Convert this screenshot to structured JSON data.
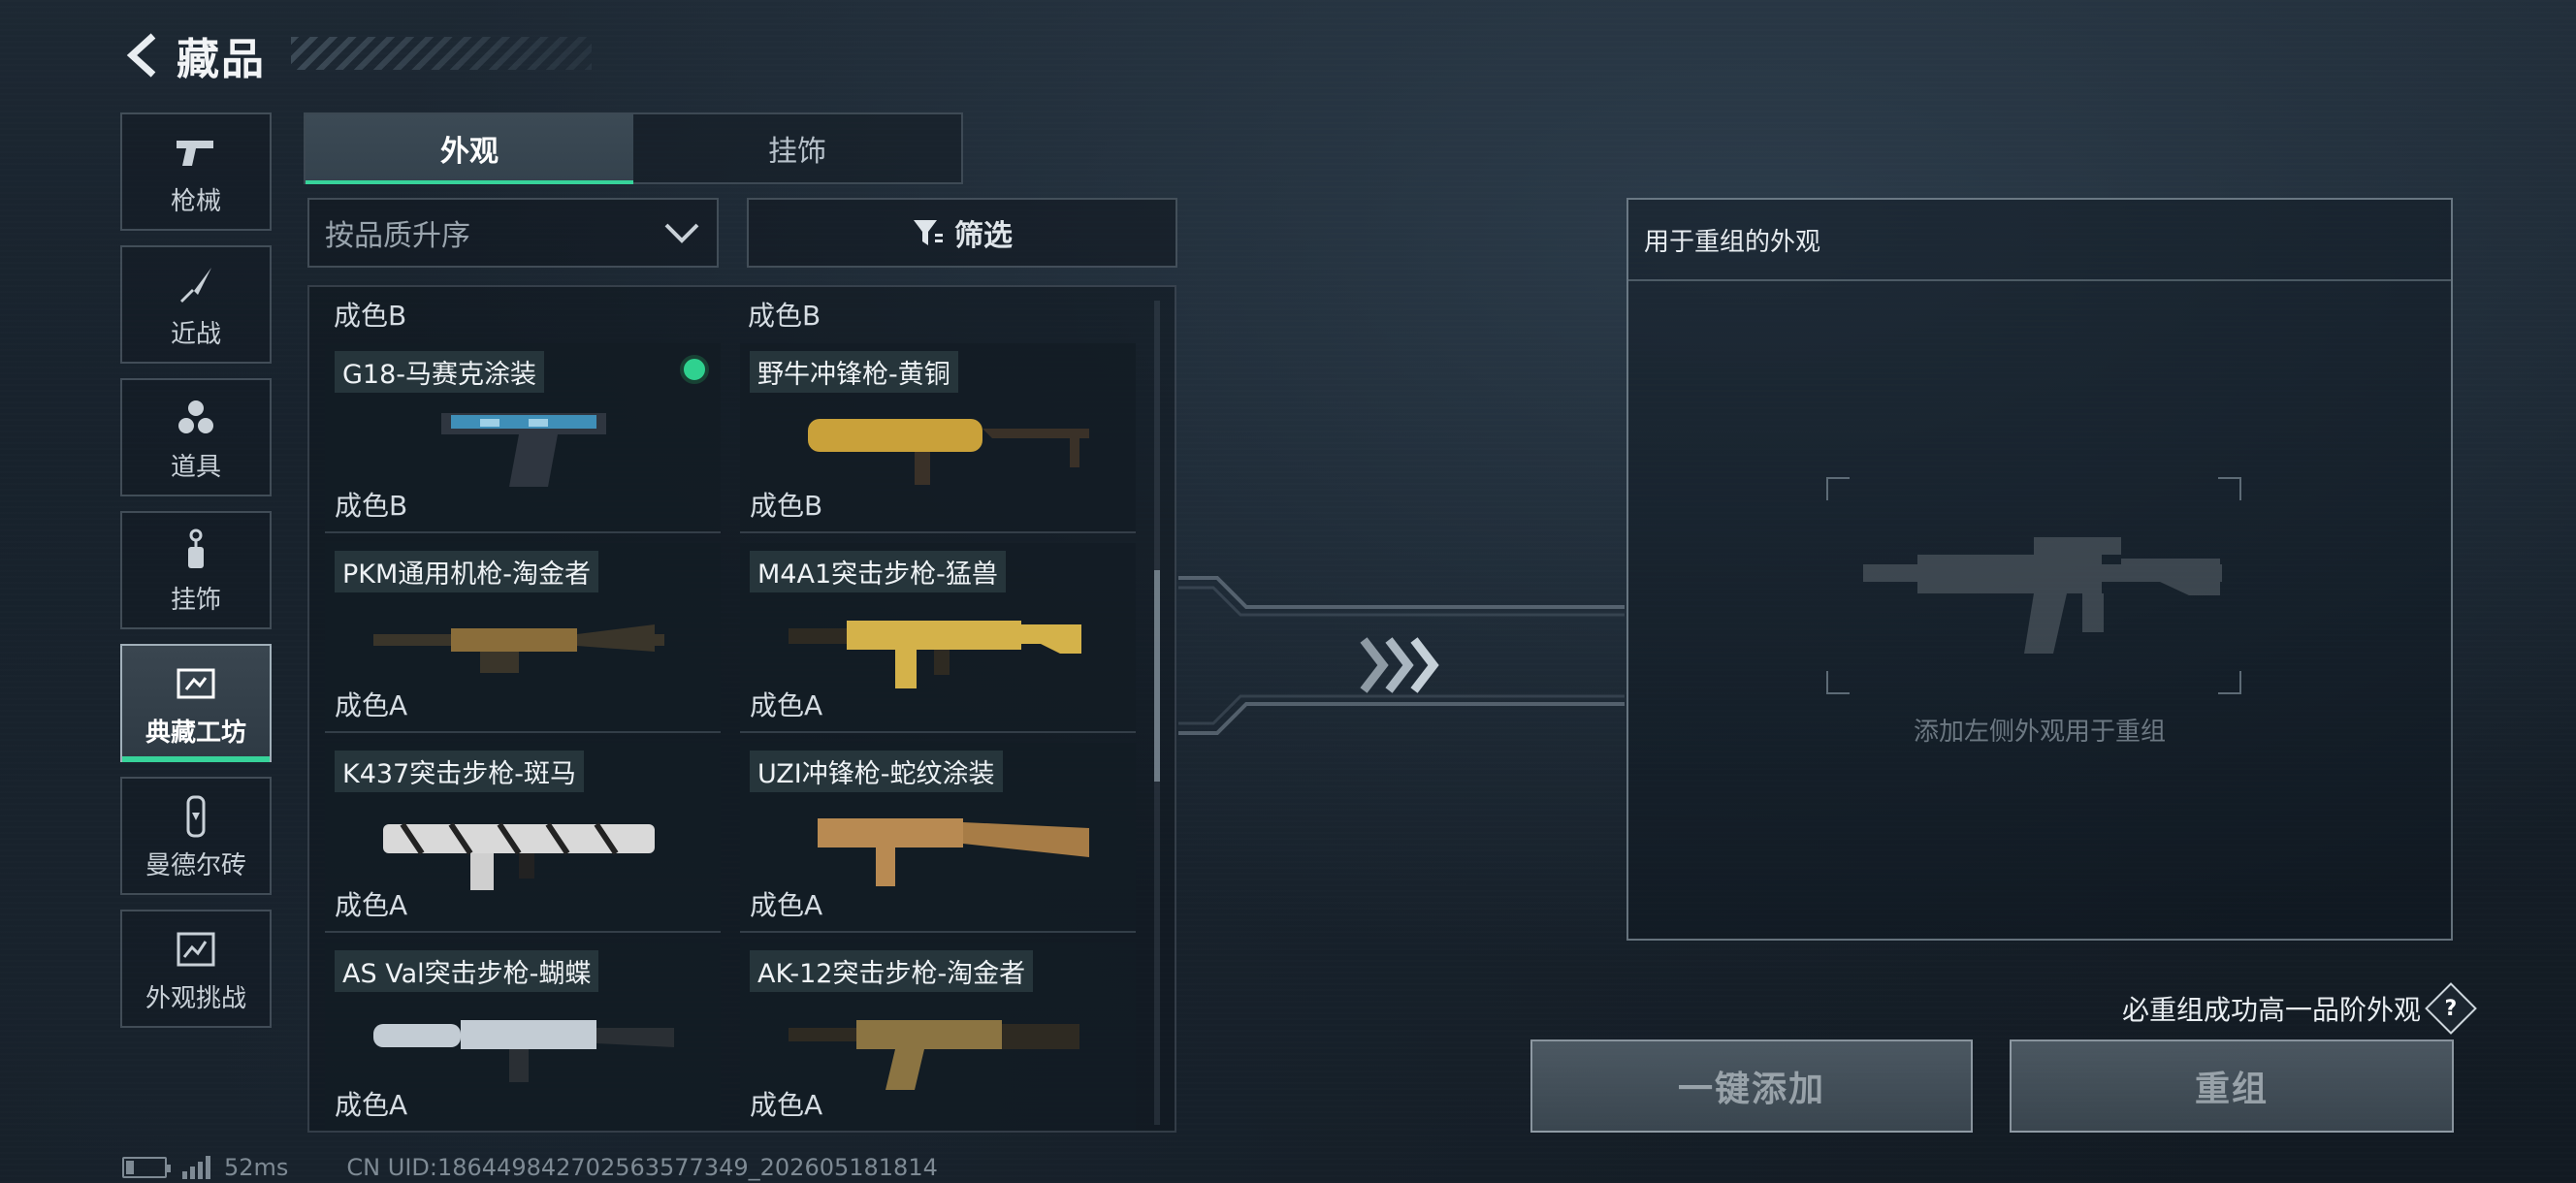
{
  "header": {
    "title": "藏品"
  },
  "sidebar": {
    "items": [
      {
        "label": "枪械",
        "icon": "pistol-icon"
      },
      {
        "label": "近战",
        "icon": "knife-icon"
      },
      {
        "label": "道具",
        "icon": "grenade-icon"
      },
      {
        "label": "挂饰",
        "icon": "charm-icon"
      },
      {
        "label": "典藏工坊",
        "icon": "workshop-icon",
        "active": true
      },
      {
        "label": "曼德尔砖",
        "icon": "mandel-brick-icon"
      },
      {
        "label": "外观挑战",
        "icon": "skin-challenge-icon"
      }
    ]
  },
  "tabs": [
    {
      "label": "外观",
      "active": true
    },
    {
      "label": "挂饰",
      "active": false
    }
  ],
  "sort": {
    "label": "按品质升序"
  },
  "filter": {
    "label": "筛选"
  },
  "grid": {
    "top_grades": [
      "成色B",
      "成色B"
    ],
    "cards": [
      {
        "name": "G18-马赛克涂装",
        "grade": "成色B",
        "selected": true,
        "color": "#3f8fb8"
      },
      {
        "name": "野牛冲锋枪-黄铜",
        "grade": "成色B",
        "selected": false,
        "color": "#c9a13a"
      },
      {
        "name": "PKM通用机枪-淘金者",
        "grade": "成色A",
        "selected": false,
        "color": "#8a6d3a"
      },
      {
        "name": "M4A1突击步枪-猛兽",
        "grade": "成色A",
        "selected": false,
        "color": "#d4b24a"
      },
      {
        "name": "K437突击步枪-斑马",
        "grade": "成色A",
        "selected": false,
        "color": "#d9d9d9"
      },
      {
        "name": "UZI冲锋枪-蛇纹涂装",
        "grade": "成色A",
        "selected": false,
        "color": "#b88a52"
      },
      {
        "name": "AS Val突击步枪-蝴蝶",
        "grade": "成色A",
        "selected": false,
        "color": "#c3ccd4"
      },
      {
        "name": "AK-12突击步枪-淘金者",
        "grade": "成色A",
        "selected": false,
        "color": "#8b7442"
      }
    ]
  },
  "panel": {
    "title": "用于重组的外观",
    "hint": "添加左侧外观用于重组"
  },
  "guarantee": {
    "text": "必重组成功高一品阶外观",
    "help": "?"
  },
  "buttons": {
    "one_click": "一键添加",
    "reform": "重组"
  },
  "footer": {
    "ping": "52ms",
    "uid": "CN UID:1864498427025635773​49_202605181814"
  },
  "colors": {
    "accent": "#37d39a",
    "panel_border": "#aab9c4"
  }
}
